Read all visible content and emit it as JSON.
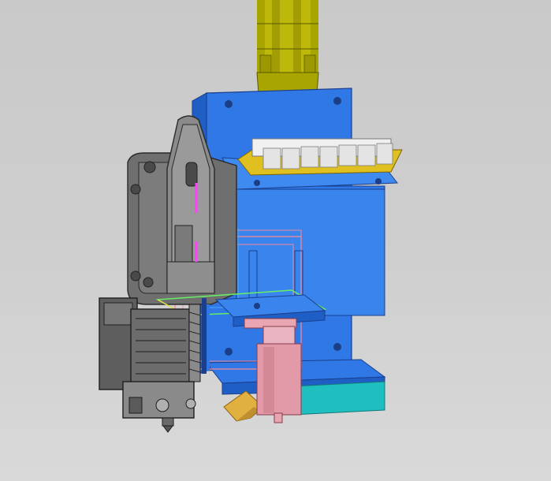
{
  "viewport": {
    "background_top": "#c9c9c9",
    "background_bottom": "#d9d9d9"
  },
  "model": {
    "parts": [
      {
        "name": "yellow-linear-rail",
        "color": "#a8a400"
      },
      {
        "name": "blue-mounting-plate",
        "color": "#2f78e6"
      },
      {
        "name": "grey-extruder-body",
        "color": "#6f6f6f"
      },
      {
        "name": "connector-block",
        "color": "#e8e8e8"
      },
      {
        "name": "pcb-strip",
        "color": "#e0c020"
      },
      {
        "name": "pink-nozzle-assembly",
        "color": "#e8a6b2"
      },
      {
        "name": "cyan-base-block",
        "color": "#1fbfbf"
      },
      {
        "name": "orange-fan-duct",
        "color": "#e0b040"
      },
      {
        "name": "green-sketch-plane",
        "color": "#66ee66"
      },
      {
        "name": "magenta-axis-line",
        "color": "#ff40ff"
      }
    ]
  }
}
